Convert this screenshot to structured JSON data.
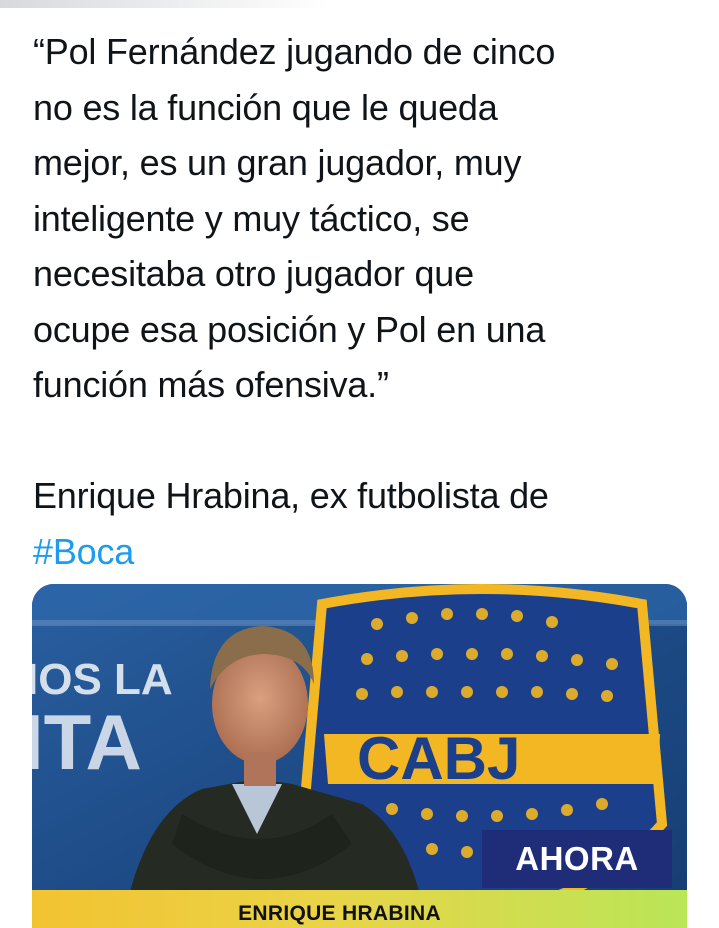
{
  "tweet": {
    "quote_lines": [
      "“Pol Fernández jugando de cinco",
      "no es la función que le queda",
      "mejor, es un gran jugador, muy",
      "inteligente y muy táctico, se",
      "necesitaba otro jugador que",
      "ocupe esa posición y Pol en una",
      "función más ofensiva.”"
    ],
    "attribution": "Enrique Hrabina, ex futbolista de",
    "hashtag": "#Boca"
  },
  "media": {
    "background_text_left_top": "IOS LA",
    "background_text_left_bottom": "ITA",
    "crest_text": "CABJ",
    "badge": "AHORA",
    "lower_third_name": "ENRIQUE HRABINA"
  },
  "colors": {
    "text": "#0f1419",
    "link": "#1d9bf0",
    "badge_bg": "#1f2c78",
    "crest_yellow": "#f2b722",
    "bus_blue": "#1e4d86"
  }
}
